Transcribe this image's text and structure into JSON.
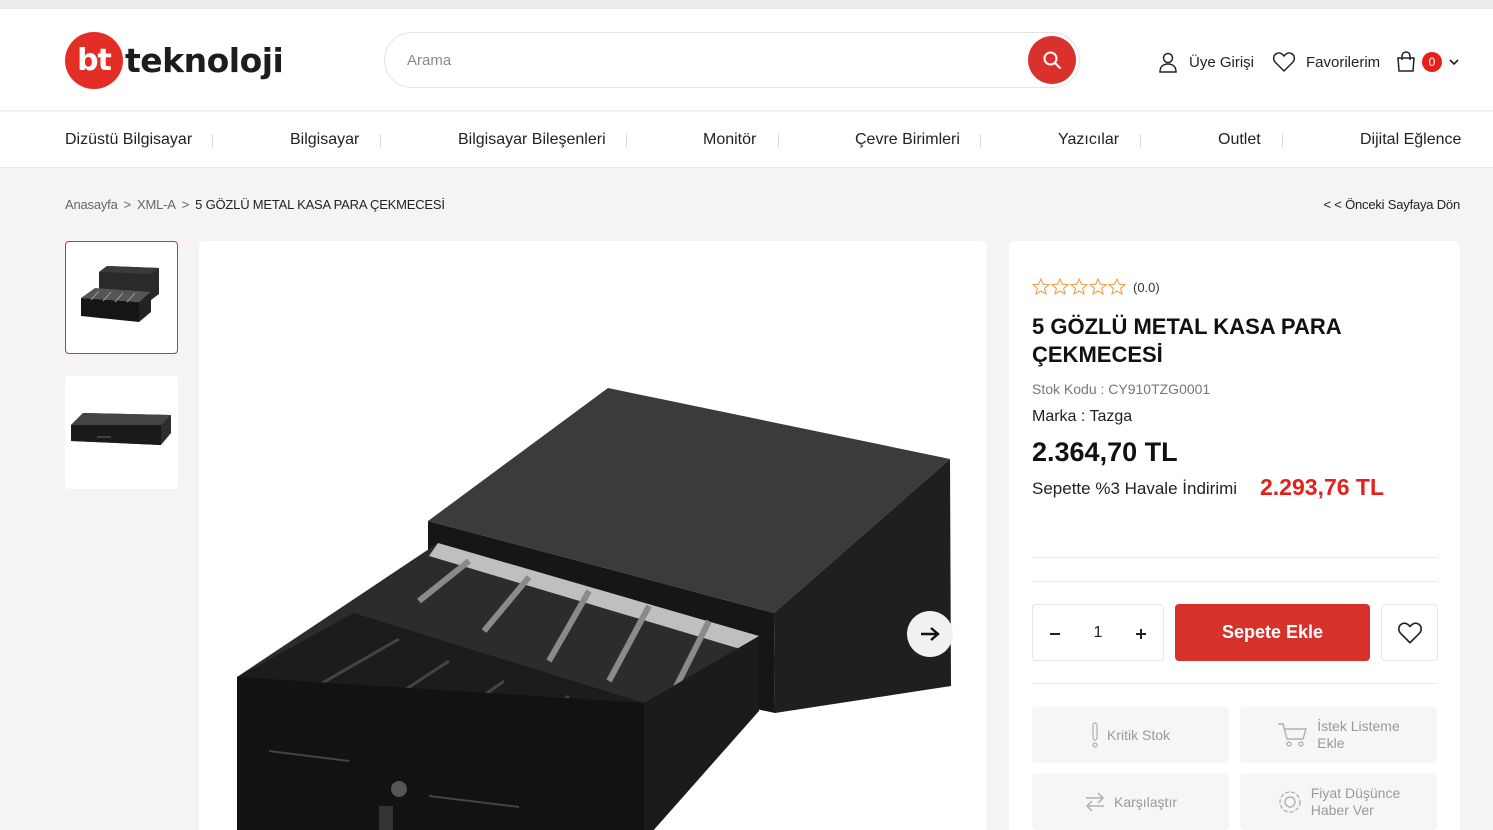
{
  "brand": {
    "badge": "bt",
    "name": "teknoloji"
  },
  "search": {
    "placeholder": "Arama"
  },
  "header_links": {
    "login": "Üye Girişi",
    "favorites": "Favorilerim",
    "cart_count": "0"
  },
  "nav": [
    "Dizüstü Bilgisayar",
    "Bilgisayar",
    "Bilgisayar Bileşenleri",
    "Monitör",
    "Çevre Birimleri",
    "Yazıcılar",
    "Outlet",
    "Dijital Eğlence"
  ],
  "breadcrumb": {
    "home": "Anasayfa",
    "sep1": ">",
    "category": "XML-A",
    "sep2": ">",
    "current": "5 GÖZLÜ METAL KASA PARA ÇEKMECESİ"
  },
  "back_link": "< < Önceki Sayfaya Dön",
  "product": {
    "rating": "(0.0)",
    "stars": 0,
    "title": "5 GÖZLÜ METAL KASA PARA ÇEKMECESİ",
    "stock_code": "Stok Kodu : CY910TZG0001",
    "brand": "Marka : Tazga",
    "price": "2.364,70 TL",
    "discount_label": "Sepette %3 Havale İndirimi",
    "discount_price": "2.293,76 TL",
    "quantity": "1",
    "add_to_cart": "Sepete Ekle"
  },
  "actions": {
    "critical_stock": "Kritik Stok",
    "wishlist_line1": "İstek Listeme",
    "wishlist_line2": "Ekle",
    "compare": "Karşılaştır",
    "price_alert_line1": "Fiyat Düşünce",
    "price_alert_line2": "Haber Ver"
  },
  "icons": [
    "search-icon",
    "user-icon",
    "heart-icon",
    "bag-icon",
    "chevron-down-icon",
    "arrow-right-icon",
    "star-icon",
    "minus-icon",
    "plus-icon",
    "exclamation-icon",
    "cart-icon",
    "compare-icon",
    "badge-icon"
  ],
  "colors": {
    "accent": "#d9312b",
    "discount": "#e5201c",
    "star": "#f0a04b"
  }
}
